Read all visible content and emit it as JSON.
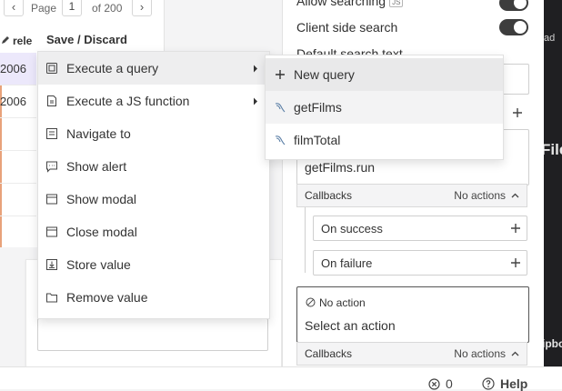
{
  "table": {
    "pager": {
      "prev": "‹",
      "page_word": "Page",
      "page_number": "1",
      "of_pages": "of 200",
      "next": "›"
    },
    "column_header": "rele",
    "rows": [
      "2006",
      "2006",
      "",
      "",
      ""
    ],
    "save_discard": "Save / Discard"
  },
  "property_pane": {
    "allow_searching_label": "Allow searching",
    "allow_searching_badge": "JS",
    "client_side_search_label": "Client side search",
    "default_search_text_label": "Default search text",
    "action_value": "getFilms.run",
    "callbacks_label": "Callbacks",
    "no_actions_label": "No actions",
    "on_success_label": "On success",
    "on_failure_label": "On failure",
    "no_action_label": "No action",
    "select_action_label": "Select an action",
    "callbacks_label_2": "Callbacks",
    "no_actions_label_2": "No actions"
  },
  "action_menu": {
    "items": [
      {
        "label": "Execute a query",
        "icon": "query-icon",
        "submenu": true
      },
      {
        "label": "Execute a JS function",
        "icon": "js-function-icon",
        "submenu": true
      },
      {
        "label": "Navigate to",
        "icon": "navigate-icon",
        "submenu": false
      },
      {
        "label": "Show alert",
        "icon": "alert-icon",
        "submenu": false
      },
      {
        "label": "Show modal",
        "icon": "modal-icon",
        "submenu": false
      },
      {
        "label": "Close modal",
        "icon": "modal-icon",
        "submenu": false
      },
      {
        "label": "Store value",
        "icon": "store-icon",
        "submenu": false
      },
      {
        "label": "Remove value",
        "icon": "folder-icon",
        "submenu": false
      }
    ]
  },
  "query_submenu": {
    "new_query": "New query",
    "queries": [
      "getFilms",
      "filmTotal"
    ]
  },
  "bottom_bar": {
    "error_count": "0",
    "help_label": "Help"
  },
  "dark_strip": {
    "text_1": "ad",
    "text_2": "File",
    "text_3": "ipbo"
  },
  "colors": {
    "accent_highlight": "#ece8fb",
    "toggle_on": "#3d3d3d",
    "table_edge": "#e8a27a"
  }
}
